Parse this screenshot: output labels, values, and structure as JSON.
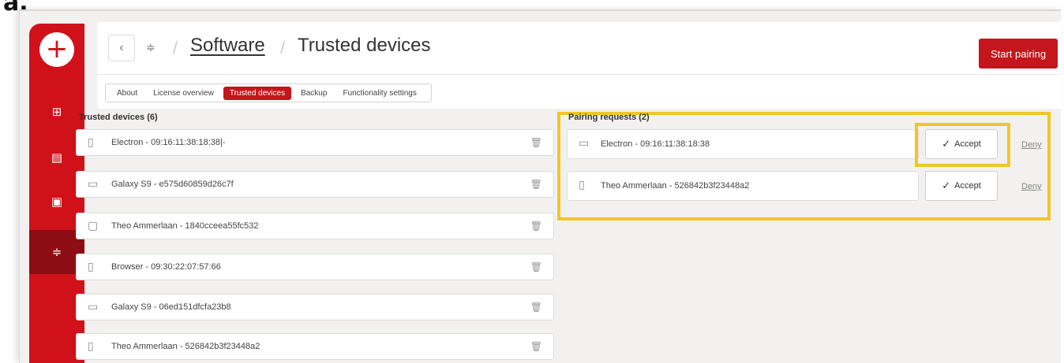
{
  "corner_label": "a.",
  "nav": {
    "add_symbol": "+",
    "items": [
      {
        "icon": "grid-icon",
        "glyph": "⊞"
      },
      {
        "icon": "clipboard-icon",
        "glyph": "▤"
      },
      {
        "icon": "document-check-icon",
        "glyph": "▣"
      },
      {
        "icon": "sliders-icon",
        "glyph": "≑"
      }
    ]
  },
  "header": {
    "back_glyph": "‹",
    "sliders_glyph": "≑",
    "separator": "/",
    "breadcrumb_link": "Software",
    "breadcrumb_current": "Trusted devices",
    "start_pairing": "Start pairing"
  },
  "tabs": [
    "About",
    "License overview",
    "Trusted devices",
    "Backup",
    "Functionality settings"
  ],
  "trusted": {
    "title": "Trusted devices (6)",
    "devices": [
      {
        "name": "Electron - 09:16:11:38:18:38|-",
        "icon": "phone-icon",
        "glyph": "▯"
      },
      {
        "name": "Galaxy S9 - e575d60859d26c7f",
        "icon": "monitor-icon",
        "glyph": "▭"
      },
      {
        "name": "Theo Ammerlaan - 1840cceea55fc532",
        "icon": "laptop-icon",
        "glyph": "▢"
      },
      {
        "name": "Browser - 09:30:22:07:57:66",
        "icon": "phone-icon",
        "glyph": "▯"
      },
      {
        "name": "Galaxy S9 - 06ed151dfcfa23b8",
        "icon": "monitor-icon",
        "glyph": "▭"
      },
      {
        "name": "Theo Ammerlaan - 526842b3f23448a2",
        "icon": "phone-icon",
        "glyph": "▯"
      }
    ],
    "trash_glyph": "🗑"
  },
  "pairing": {
    "title": "Pairing requests (2)",
    "requests": [
      {
        "name": "Electron - 09:16:11:38:18:38",
        "icon": "monitor-icon",
        "glyph": "▭"
      },
      {
        "name": "Theo Ammerlaan - 526842b3f23448a2",
        "icon": "phone-icon",
        "glyph": "▯"
      }
    ],
    "accept_label": "Accept",
    "accept_glyph": "✓",
    "deny_label": "Deny"
  },
  "colors": {
    "brand_red": "#c4161c",
    "rail_red": "#d0111a",
    "highlight_yellow": "#f2c526"
  }
}
